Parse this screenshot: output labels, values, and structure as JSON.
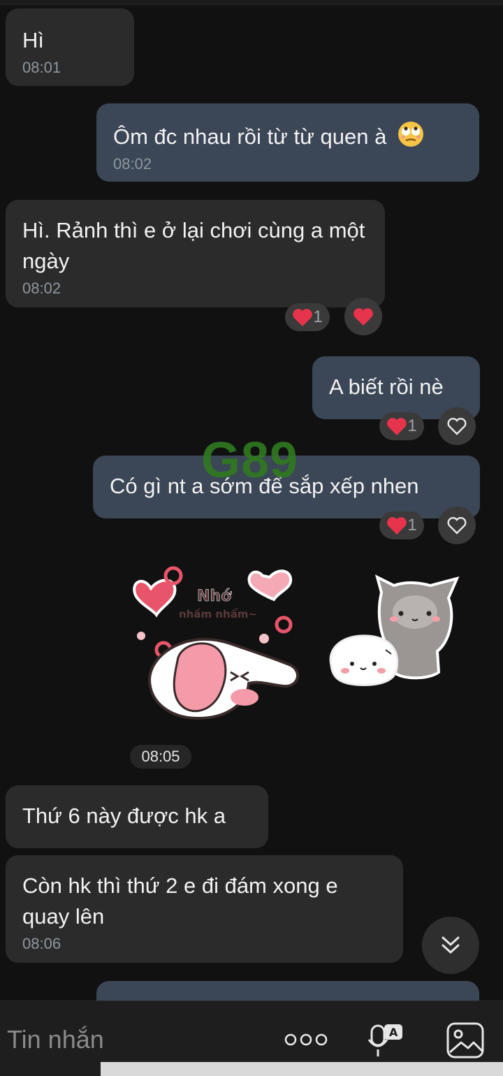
{
  "messages": [
    {
      "text": "Hì",
      "time": "08:01",
      "side": "in"
    },
    {
      "text": "Ôm đc nhau rồi từ từ quen à",
      "time": "08:02",
      "side": "out",
      "emoji": "eye-roll-face"
    },
    {
      "text": "Hì. Rảnh thì e ở lại chơi cùng a một ngày",
      "time": "08:02",
      "side": "in",
      "reaction_count": "1"
    },
    {
      "text": "A biết rồi nè",
      "side": "out",
      "reaction_count": "1"
    },
    {
      "text": "Có gì nt a sớm để sắp xếp nhen",
      "side": "out",
      "reaction_count": "1"
    },
    {
      "text": "Thứ 6 này được hk a",
      "side": "in"
    },
    {
      "text": "Còn hk thì thứ 2 e đi đám xong e quay lên",
      "time": "08:06",
      "side": "in"
    }
  ],
  "stickers": {
    "sticker1_text": "Nhớ",
    "sticker1_subtext": "nhấm nhẩm~",
    "time": "08:05"
  },
  "watermark": "G89",
  "composer": {
    "placeholder": "Tin nhắn",
    "icons": [
      "more-icon",
      "voice-to-text-icon",
      "image-icon"
    ]
  },
  "colors": {
    "background": "#111111",
    "incoming_bubble": "#2b2b2b",
    "outgoing_bubble": "#3b4656",
    "heart": "#e5344b"
  }
}
